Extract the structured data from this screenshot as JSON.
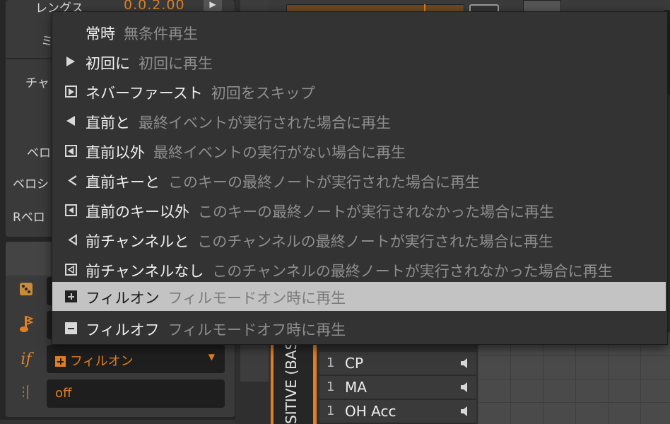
{
  "inspector": {
    "length_label": "レングス",
    "length_value": "0.0.2.00",
    "partial_labels": [
      "ミ",
      "チャ",
      "ベロ",
      "ベロシ",
      "Rベロ"
    ],
    "condition_dropdown": "フィルオン",
    "repeat_field": "off",
    "condition_icon_text": "if"
  },
  "lane": {
    "label": "SITIVE (BAS",
    "keys": [
      {
        "num": "1",
        "name": "CP"
      },
      {
        "num": "1",
        "name": "MA"
      },
      {
        "num": "1",
        "name": "OH Acc"
      }
    ]
  },
  "menu": {
    "highlighted_index": 9,
    "items": [
      {
        "label": "常時",
        "desc": "無条件再生",
        "icon": "none"
      },
      {
        "label": "初回に",
        "desc": "初回に再生",
        "icon": "play-icon"
      },
      {
        "label": "ネバーファースト",
        "desc": "初回をスキップ",
        "icon": "boxed-play-icon"
      },
      {
        "label": "直前と",
        "desc": "最終イベントが実行された場合に再生",
        "icon": "left-triangle-icon"
      },
      {
        "label": "直前以外",
        "desc": "最終イベントの実行がない場合に再生",
        "icon": "boxed-left-triangle-icon"
      },
      {
        "label": "直前キーと",
        "desc": "このキーの最終ノートが実行された場合に再生",
        "icon": "less-than-icon"
      },
      {
        "label": "直前のキー以外",
        "desc": "このキーの最終ノートが実行されなかった場合に再生",
        "icon": "boxed-less-than-icon"
      },
      {
        "label": "前チャンネルと",
        "desc": "このチャンネルの最終ノートが実行された場合に再生",
        "icon": "outline-left-triangle-icon"
      },
      {
        "label": "前チャンネルなし",
        "desc": "このチャンネルの最終ノートが実行されなかった場合に再生",
        "icon": "boxed-outline-left-icon"
      },
      {
        "label": "フィルオン",
        "desc": "フィルモードオン時に再生",
        "icon": "plus-box-icon"
      },
      {
        "label": "フィルオフ",
        "desc": "フィルモードオフ時に再生",
        "icon": "minus-box-icon"
      }
    ]
  },
  "colors": {
    "accent": "#e07f22",
    "menu_bg": "#333333",
    "highlight": "#c3c3c3"
  }
}
